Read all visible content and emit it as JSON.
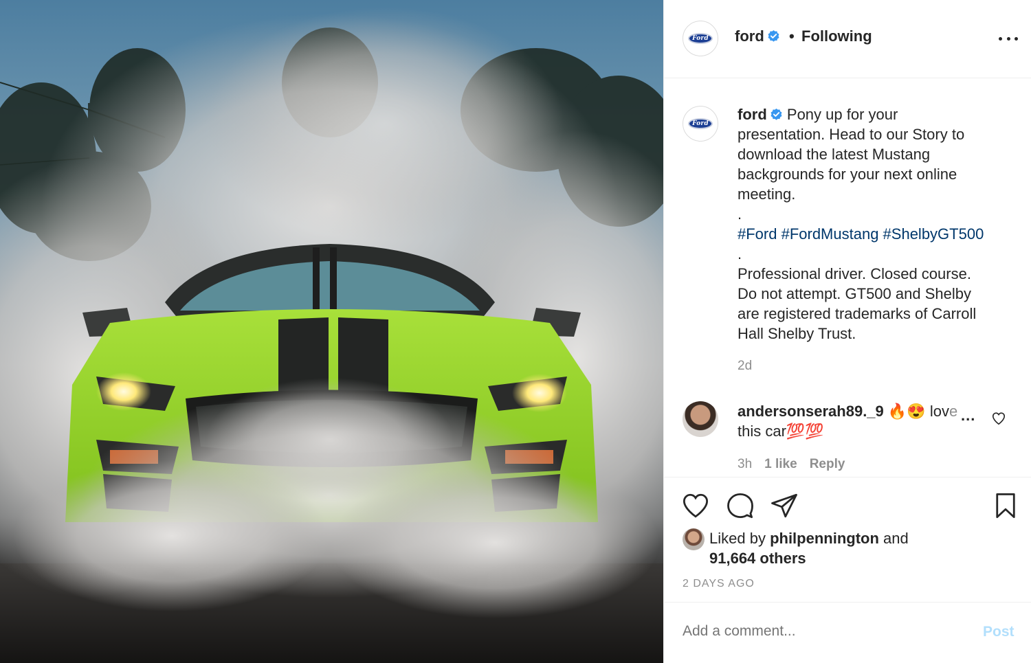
{
  "post_image": {
    "subject": "lime green Ford Mustang Shelby GT500 doing a burnout surrounded by tire smoke"
  },
  "header": {
    "username": "ford",
    "separator": "•",
    "follow_status": "Following",
    "more_icon": "more-dots-icon"
  },
  "caption": {
    "username": "ford",
    "lines": [
      "Pony up for your",
      "presentation. Head to our Story to",
      "download the latest Mustang",
      "backgrounds for your next online",
      "meeting.",
      "."
    ],
    "hashtags": "#Ford #FordMustang #ShelbyGT500",
    "dot2": ".",
    "disclaimer_lines": [
      "Professional driver. Closed course.",
      "Do not attempt. GT500 and Shelby",
      "are registered trademarks of Carroll",
      "Hall Shelby Trust."
    ],
    "time": "2d"
  },
  "comment": {
    "username": "andersonserah89._9",
    "emoji": "🔥😍",
    "text_start": "lov",
    "text_faded": "e",
    "more": "...",
    "line2": "this car",
    "line2_emoji": "💯💯",
    "time": "3h",
    "likes": "1 like",
    "reply": "Reply"
  },
  "actions": {
    "like_icon": "heart-icon",
    "comment_icon": "comment-bubble-icon",
    "share_icon": "paper-plane-icon",
    "save_icon": "bookmark-icon"
  },
  "likes": {
    "prefix": "Liked by ",
    "user": "philpennington",
    "middle": " and",
    "others": "91,664 others"
  },
  "posted": "2 DAYS AGO",
  "add_comment": {
    "placeholder": "Add a comment...",
    "post_label": "Post"
  },
  "colors": {
    "text": "#262626",
    "muted": "#8e8e8e",
    "hashtag": "#00376b",
    "verified": "#3897f0",
    "post_disabled": "#b2dffc",
    "car": "#9fdc2c"
  }
}
